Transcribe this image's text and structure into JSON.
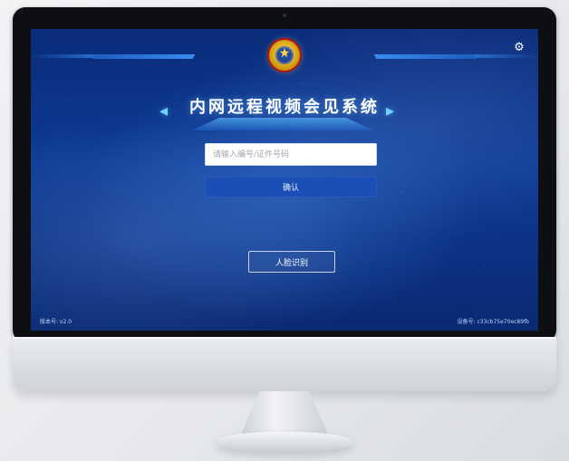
{
  "app": {
    "title": "内网远程视频会见系统",
    "input_placeholder": "请输入编号/证件号码",
    "confirm_label": "确认",
    "face_button_label": "人脸识别",
    "version_text": "版本号: v2.0",
    "device_text": "设备号: c33cb75e70ec89fb"
  },
  "icons": {
    "settings": "gear-icon",
    "emblem": "police-emblem-icon",
    "left_decoration": "left-arrow-decoration-icon",
    "right_decoration": "right-arrow-decoration-icon"
  },
  "colors": {
    "primary_blue": "#1c4fb6",
    "screen_blue": "#0d3a94",
    "text_white": "#ffffff"
  }
}
